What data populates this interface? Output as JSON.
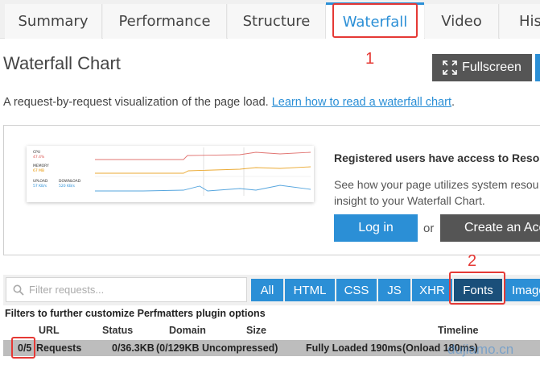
{
  "tabs": [
    {
      "label": "Summary"
    },
    {
      "label": "Performance"
    },
    {
      "label": "Structure"
    },
    {
      "label": "Waterfall",
      "active": true
    },
    {
      "label": "Video"
    },
    {
      "label": "His"
    }
  ],
  "annotations": {
    "first": "1",
    "second": "2"
  },
  "page": {
    "title": "Waterfall Chart",
    "fullscreen_label": "Fullscreen",
    "description": "A request-by-request visualization of the page load.",
    "learn_link": "Learn how to read a waterfall chart",
    "description_end": "."
  },
  "promo": {
    "thumbnail": {
      "cpu_label": "CPU",
      "cpu_value": "47.4%",
      "memory_label": "MEMORY",
      "memory_value": "67 MB",
      "upload_label": "UPLOAD",
      "upload_value": "57 KB/s",
      "download_label": "DOWNLOAD",
      "download_value": "520 KB/s"
    },
    "heading": "Registered users have access to Reso",
    "text_line1": "See how your page utilizes system resou",
    "text_line2": "insight to your Waterfall Chart.",
    "login_label": "Log in",
    "or_label": "or",
    "create_label": "Create an Acc"
  },
  "filters": {
    "search_placeholder": "Filter requests...",
    "buttons": [
      {
        "label": "All"
      },
      {
        "label": "HTML"
      },
      {
        "label": "CSS"
      },
      {
        "label": "JS"
      },
      {
        "label": "XHR"
      },
      {
        "label": "Fonts",
        "selected": true
      },
      {
        "label": "Image"
      }
    ],
    "note": "Filters to further customize Perfmatters plugin options"
  },
  "table": {
    "headers": {
      "url": "URL",
      "status": "Status",
      "domain": "Domain",
      "size": "Size",
      "timeline": "Timeline"
    },
    "summary": {
      "count": "0/5",
      "requests": "Requests",
      "size": "0/36.3KB",
      "uncompressed": "(0/129KB Uncompressed)",
      "loaded": "Fully Loaded 190ms",
      "onload": "(Onload 180ms)"
    }
  },
  "watermark": "dujiamo.cn",
  "colors": {
    "accent": "#2b8fd6",
    "selected": "#1a4f7a",
    "annotation": "#e53935"
  }
}
